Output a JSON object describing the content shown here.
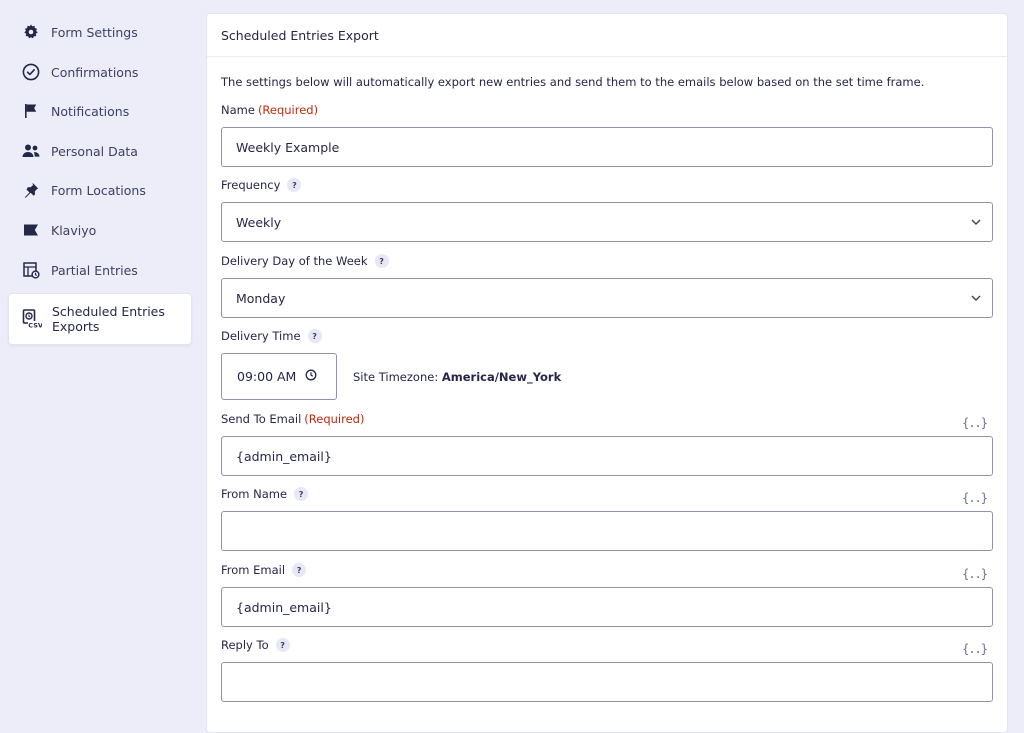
{
  "sidebar": {
    "items": [
      {
        "label": "Form Settings",
        "icon": "gear-icon"
      },
      {
        "label": "Confirmations",
        "icon": "check-circle-icon"
      },
      {
        "label": "Notifications",
        "icon": "flag-icon"
      },
      {
        "label": "Personal Data",
        "icon": "users-icon"
      },
      {
        "label": "Form Locations",
        "icon": "pin-icon"
      },
      {
        "label": "Klaviyo",
        "icon": "klaviyo-flag-icon"
      },
      {
        "label": "Partial Entries",
        "icon": "partial-entries-icon"
      },
      {
        "label": "Scheduled Entries Exports",
        "icon": "csv-export-icon",
        "active": true
      }
    ]
  },
  "panel": {
    "title": "Scheduled Entries Export",
    "description": "The settings below will automatically export new entries and send them to the emails below based on the set time frame.",
    "required_text": "(Required)",
    "help_glyph": "?",
    "merge_tag_glyph": "{..}",
    "fields": {
      "name": {
        "label": "Name",
        "value": "Weekly Example"
      },
      "frequency": {
        "label": "Frequency",
        "value": "Weekly"
      },
      "delivery_day": {
        "label": "Delivery Day of the Week",
        "value": "Monday"
      },
      "delivery_time": {
        "label": "Delivery Time",
        "value": "09:00 AM"
      },
      "timezone": {
        "label": "Site Timezone:",
        "value": "America/New_York"
      },
      "send_to": {
        "label": "Send To Email",
        "value": "{admin_email}"
      },
      "from_name": {
        "label": "From Name",
        "value": ""
      },
      "from_email": {
        "label": "From Email",
        "value": "{admin_email}"
      },
      "reply_to": {
        "label": "Reply To",
        "value": ""
      }
    }
  },
  "colors": {
    "accent_required": "#c02b0a",
    "border": "#9092b2",
    "background": "#ecedf8"
  }
}
